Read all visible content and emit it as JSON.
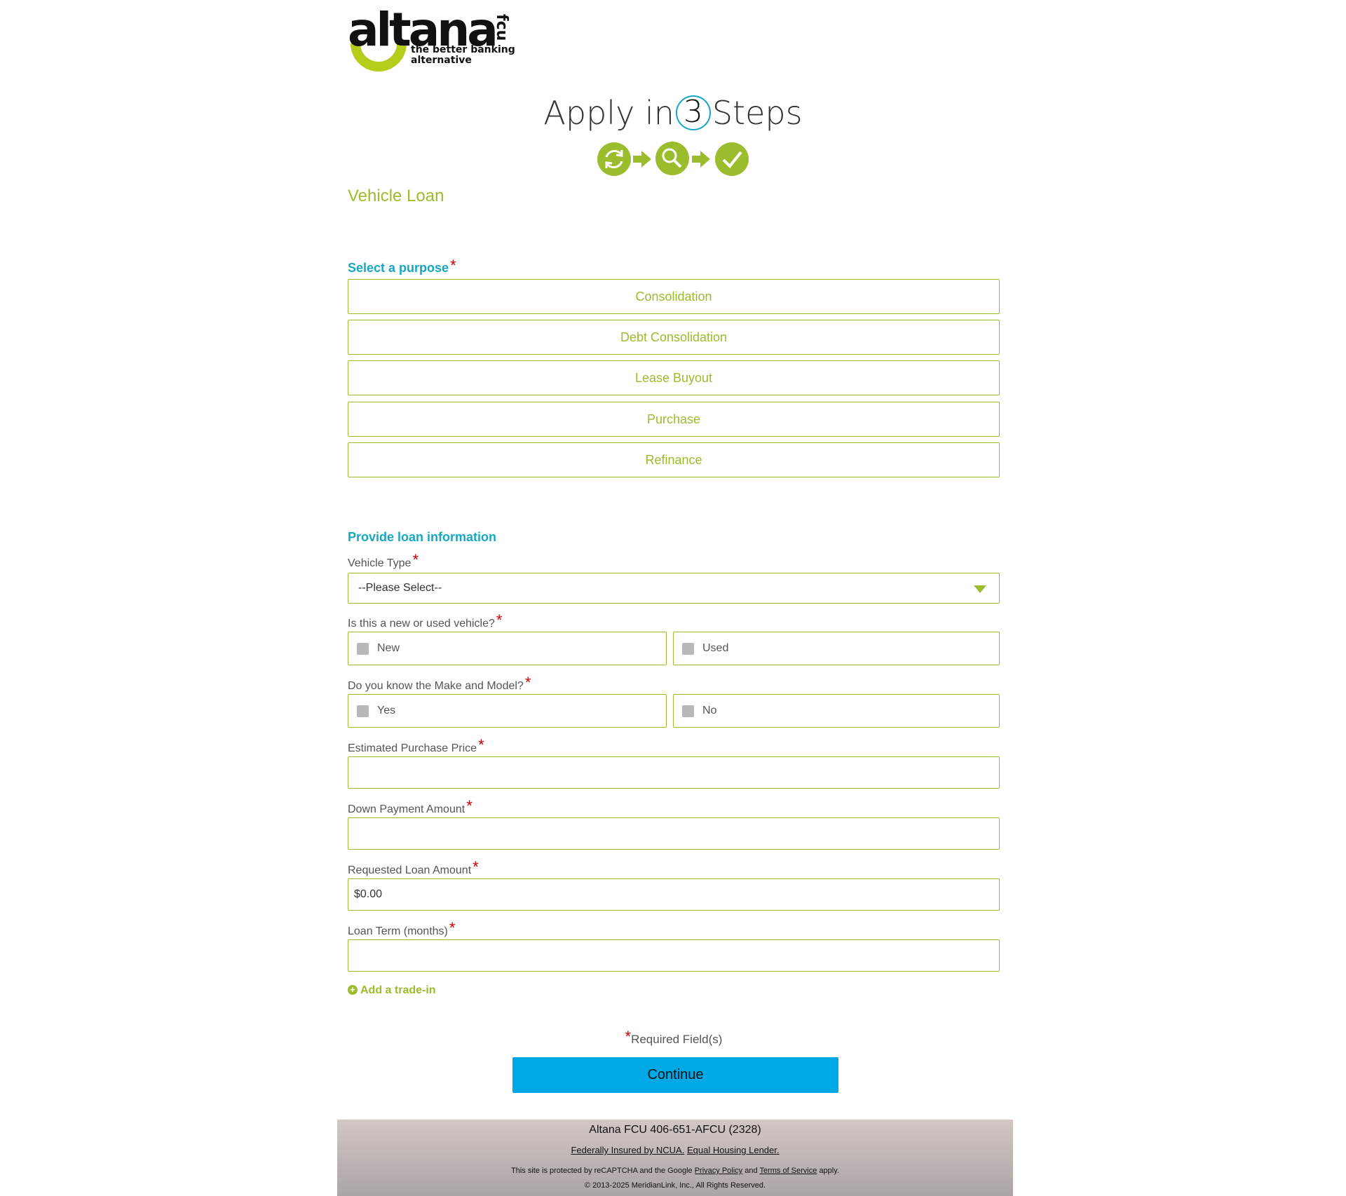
{
  "brand": {
    "logo_word": "altana",
    "logo_suffix": "fcu",
    "tagline_line1": "the better banking",
    "tagline_line2": "alternative",
    "accent_green": "#9bbc2c",
    "accent_teal": "#17a7c2",
    "button_blue": "#00a9e6"
  },
  "header": {
    "apply_prefix": "Apply in",
    "apply_number": "3",
    "apply_suffix": "Steps",
    "step_icons": [
      "refresh-icon",
      "arrow-right-icon",
      "search-icon",
      "arrow-right-icon",
      "checkmark-icon"
    ]
  },
  "page_title": "Vehicle Loan",
  "purpose": {
    "label": "Select a purpose",
    "required_mark": "*",
    "options": [
      "Consolidation",
      "Debt Consolidation",
      "Lease Buyout",
      "Purchase",
      "Refinance"
    ]
  },
  "loan_info": {
    "label": "Provide loan information",
    "vehicle_type": {
      "label": "Vehicle Type",
      "required_mark": "*",
      "selected": "--Please Select--"
    },
    "new_or_used": {
      "label": "Is this a new or used vehicle?",
      "required_mark": "*",
      "options": [
        "New",
        "Used"
      ]
    },
    "make_model": {
      "label": "Do you know the Make and Model?",
      "required_mark": "*",
      "options": [
        "Yes",
        "No"
      ]
    },
    "purchase_price": {
      "label": "Estimated Purchase Price",
      "required_mark": "*",
      "value": ""
    },
    "down_payment": {
      "label": "Down Payment Amount",
      "required_mark": "*",
      "value": ""
    },
    "requested_amount": {
      "label": "Requested Loan Amount",
      "required_mark": "*",
      "value": "$0.00"
    },
    "loan_term": {
      "label": "Loan Term (months)",
      "required_mark": "*",
      "value": ""
    },
    "trade_in_link": "Add a trade-in"
  },
  "form_footer": {
    "required_mark": "*",
    "required_text": "Required Field(s)",
    "continue_label": "Continue"
  },
  "footer": {
    "phone_line": "Altana FCU 406-651-AFCU (2328)",
    "insured_link": "Federally Insured by NCUA.",
    "housing_link": "Equal Housing Lender.",
    "captcha_prefix": "This site is protected by reCAPTCHA and the Google",
    "privacy_link": "Privacy Policy",
    "and_text": "and",
    "terms_link": "Terms of Service",
    "apply_text": "apply.",
    "copyright": "© 2013-2025 MeridianLink, Inc., All Rights Reserved."
  }
}
